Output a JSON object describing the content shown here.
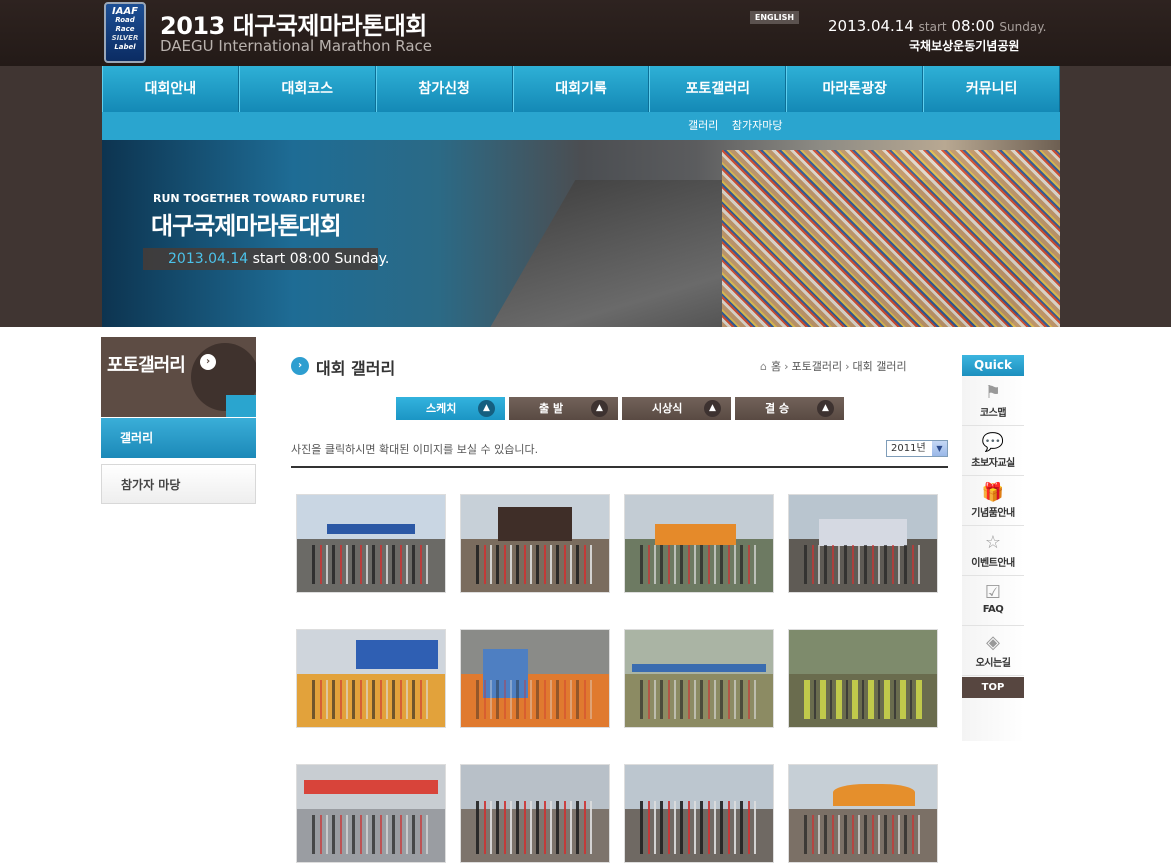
{
  "header": {
    "logo": {
      "line1": "IAAF",
      "line2": "Road Race",
      "line3": "SILVER",
      "line4": "Label"
    },
    "title": "2013 대구국제마라톤대회",
    "subtitle": "DAEGU International Marathon Race",
    "english_label": "ENGLISH",
    "date": "2013.04.14",
    "start_label": "start",
    "start_time": "08:00",
    "day": "Sunday.",
    "venue": "국채보상운동기념공원"
  },
  "nav": {
    "items": [
      {
        "label": "대회안내"
      },
      {
        "label": "대회코스"
      },
      {
        "label": "참가신청"
      },
      {
        "label": "대회기록"
      },
      {
        "label": "포토갤러리"
      },
      {
        "label": "마라톤광장"
      },
      {
        "label": "커뮤니티"
      }
    ],
    "subitems": [
      {
        "label": "갤러리"
      },
      {
        "label": "참가자마당"
      }
    ]
  },
  "banner": {
    "tagline": "RUN TOGETHER TOWARD FUTURE!",
    "title": "대구국제마라톤대회",
    "date": "2013.04.14",
    "start_label": "start",
    "start_time": "08:00",
    "day": "Sunday."
  },
  "sidebar": {
    "title": "포토갤러리",
    "items": [
      {
        "label": "갤러리"
      },
      {
        "label": "참가자 마당"
      }
    ]
  },
  "main": {
    "title": "대회 갤러리",
    "breadcrumb": [
      "홈",
      "포토갤러리",
      "대회 갤러리"
    ],
    "tabs": [
      {
        "label": "스케치"
      },
      {
        "label": "출 발"
      },
      {
        "label": "시상식"
      },
      {
        "label": "결 승"
      }
    ],
    "instruction": "사진을 클릭하시면 확대된 이미지를 보실 수 있습니다.",
    "year_value": "2011년"
  },
  "quick": {
    "title": "Quick",
    "items": [
      {
        "label": "코스맵",
        "icon": "flag-icon",
        "glyph": "⚑"
      },
      {
        "label": "초보자교실",
        "icon": "chat-icon",
        "glyph": "💬"
      },
      {
        "label": "기념품안내",
        "icon": "gift-icon",
        "glyph": "🎁"
      },
      {
        "label": "이벤트안내",
        "icon": "star-icon",
        "glyph": "☆"
      },
      {
        "label": "FAQ",
        "icon": "checkbox-icon",
        "glyph": "☑"
      },
      {
        "label": "오시는길",
        "icon": "compass-icon",
        "glyph": "◈"
      }
    ],
    "top_label": "TOP"
  },
  "colors": {
    "header_bg": "#2a201d",
    "nav_blue": "#1c9ac8",
    "tab_brown": "#5e4e47"
  }
}
